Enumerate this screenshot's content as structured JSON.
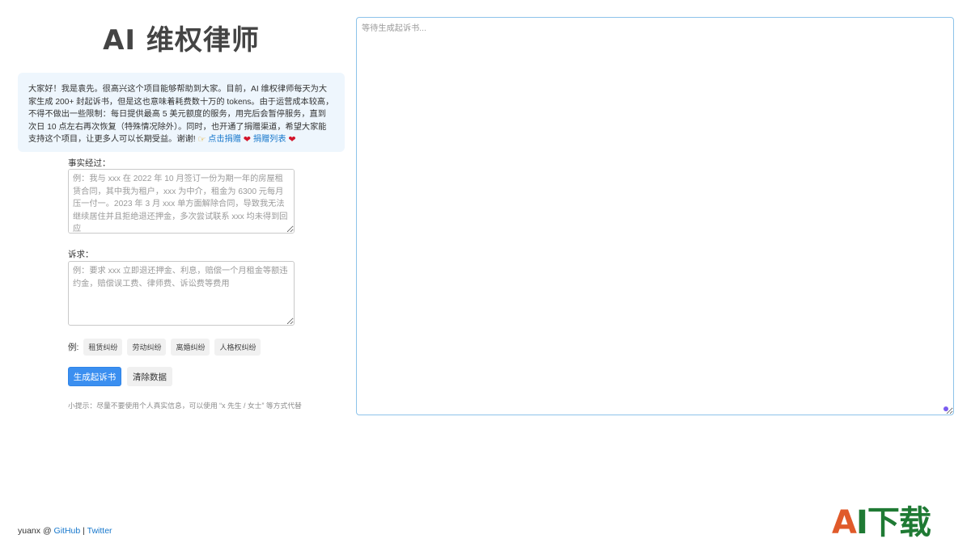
{
  "app": {
    "title": "AI 维权律师"
  },
  "notice": {
    "text": "大家好！我是袁先。很高兴这个项目能够帮助到大家。目前，AI 维权律师每天为大家生成 200+ 封起诉书，但是这也意味着耗费数十万的 tokens。由于运营成本较高，不得不做出一些限制：每日提供最高 5 美元额度的服务，用完后会暂停服务，直到次日 10 点左右再次恢复（特殊情况除外）。同时，也开通了捐赠渠道，希望大家能支持这个项目，让更多人可以长期受益。谢谢!",
    "donate_link": "点击捐赠",
    "donors_link": "捐赠列表",
    "icons": [
      "pointing-hand-icon",
      "heart-icon"
    ]
  },
  "form": {
    "facts_label": "事实经过：",
    "facts_placeholder": "例：我与 xxx 在 2022 年 10 月签订一份为期一年的房屋租赁合同，其中我为租户，xxx 为中介，租金为 6300 元每月压一付一。2023 年 3 月 xxx 单方面解除合同，导致我无法继续居住并且拒绝退还押金，多次尝试联系 xxx 均未得到回应",
    "claims_label": "诉求：",
    "claims_placeholder": "例：要求 xxx 立即退还押金、利息，赔偿一个月租金等额违约金，赔偿误工费、律师费、诉讼费等费用",
    "examples_label": "例:",
    "examples": [
      "租赁纠纷",
      "劳动纠纷",
      "离婚纠纷",
      "人格权纠纷"
    ],
    "generate_button": "生成起诉书",
    "clear_button": "清除数据",
    "tip": "小提示：尽量不要使用个人真实信息，可以使用 “x 先生 / 女士” 等方式代替"
  },
  "output": {
    "placeholder": "等待生成起诉书..."
  },
  "footer": {
    "author": "yuanx",
    "at": "@",
    "github": "GitHub",
    "separator": "|",
    "twitter": "Twitter"
  },
  "watermark": {
    "text": "AI下载"
  },
  "colors": {
    "accent": "#3b8ff0",
    "notice_bg": "#eef6fd",
    "link": "#1677cc",
    "output_border": "#8dc3ea"
  }
}
